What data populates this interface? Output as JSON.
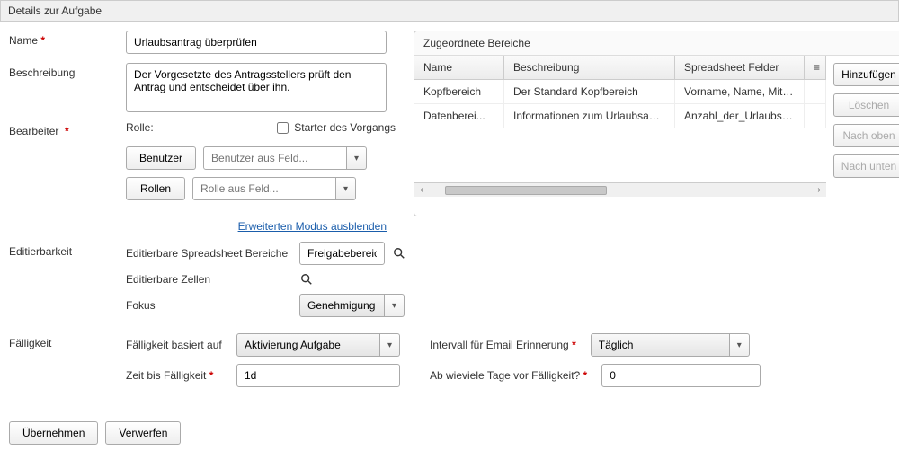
{
  "panel": {
    "title": "Details zur Aufgabe"
  },
  "fields": {
    "name_label": "Name",
    "name_value": "Urlaubsantrag überprüfen",
    "description_label": "Beschreibung",
    "description_value": "Der Vorgesetzte des Antragsstellers prüft den Antrag und entscheidet über ihn.",
    "assignee_label": "Bearbeiter",
    "role_label": "Rolle:",
    "starter_label": "Starter des Vorgangs",
    "user_btn": "Benutzer",
    "user_placeholder": "Benutzer aus Feld...",
    "roles_btn": "Rollen",
    "roles_placeholder": "Rolle aus Feld...",
    "advanced_toggle": "Erweiterten Modus ausblenden",
    "editability_label": "Editierbarkeit",
    "editable_areas_label": "Editierbare Spreadsheet Bereiche",
    "editable_areas_value": "Freigabebereich",
    "editable_cells_label": "Editierbare Zellen",
    "focus_label": "Fokus",
    "focus_value": "Genehmigung",
    "due_label": "Fälligkeit",
    "due_basis_label": "Fälligkeit basiert auf",
    "due_basis_value": "Aktivierung Aufgabe",
    "time_until_due_label": "Zeit bis Fälligkeit",
    "time_until_due_value": "1d",
    "reminder_interval_label": "Intervall für Email Erinnerung",
    "reminder_interval_value": "Täglich",
    "days_before_due_label": "Ab wieviele Tage vor Fälligkeit?",
    "days_before_due_value": "0"
  },
  "assigned_panel": {
    "title": "Zugeordnete Bereiche",
    "columns": [
      "Name",
      "Beschreibung",
      "Spreadsheet Felder"
    ],
    "rows": [
      {
        "name": "Kopfbereich",
        "desc": "Der Standard Kopfbereich",
        "fields": "Vorname, Name, Mitarbeiternummer"
      },
      {
        "name": "Datenberei...",
        "desc": "Informationen zum Urlaubsantrag",
        "fields": "Anzahl_der_Urlaubstage, Beginn"
      }
    ],
    "buttons": {
      "add": "Hinzufügen",
      "del": "Löschen",
      "up": "Nach oben",
      "down": "Nach unten"
    }
  },
  "footer": {
    "apply": "Übernehmen",
    "discard": "Verwerfen"
  }
}
